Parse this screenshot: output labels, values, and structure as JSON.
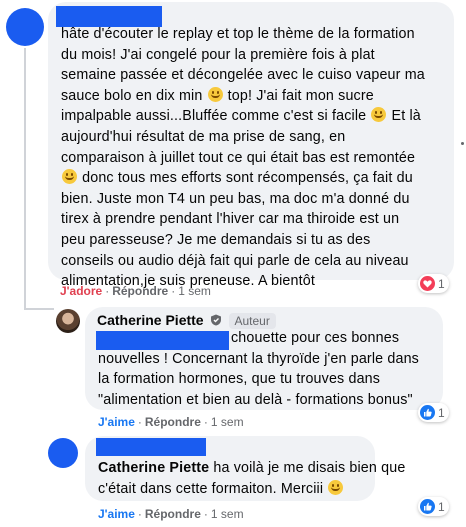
{
  "comment1": {
    "text_lines": [
      "hâte d'écouter le replay et top le thème de la formation",
      "du mois! J'ai congelé pour la première fois à plat",
      "semaine passée et décongelée avec le cuiso vapeur ma",
      "sauce bolo en dix min",
      " top! J'ai fait mon sucre",
      "impalpable aussi...Bluffée comme c'est si facile",
      " Et là",
      "aujourd'hui résultat de ma prise de sang, en",
      "comparaison à juillet tout ce qui était bas est remontée",
      " donc tous mes efforts sont récompensés, ça fait du",
      "bien. Juste mon T4 un peu bas, ma doc m'a donné du",
      "tirex à prendre pendant l'hiver car ma thiroide est un",
      "peu paresseuse? Je me demandais si tu as des",
      "conseils ou audio déjà fait qui parle de cela au niveau",
      "alimentation,je suis preneuse. A bientôt"
    ],
    "reaction_label": "J'adore",
    "reply_label": "Répondre",
    "time": "1 sem",
    "reaction_count": "1",
    "reaction_type": "heart-icon"
  },
  "reply1": {
    "author": "Catherine Piette",
    "badge": "Auteur",
    "text_lines": [
      "chouette pour ces bonnes",
      "nouvelles ! Concernant la thyroïde j'en parle dans",
      "la formation hormones, que tu trouves dans",
      "\"alimentation et bien au delà - formations bonus\""
    ],
    "reaction_label": "J'aime",
    "reply_label": "Répondre",
    "time": "1 sem",
    "reaction_count": "1",
    "reaction_type": "like-icon"
  },
  "reply2": {
    "author": "Catherine Piette",
    "text_lines": [
      " ha voilà je me disais bien que",
      "c'était dans cette formaiton. Merciii"
    ],
    "reaction_label": "J'aime",
    "reply_label": "Répondre",
    "time": "1 sem",
    "reaction_count": "1",
    "reaction_type": "like-icon"
  },
  "colors": {
    "redaction": "#1a5cf0",
    "bubble": "#f0f2f5",
    "adore": "#e04050",
    "like": "#1877f2"
  }
}
